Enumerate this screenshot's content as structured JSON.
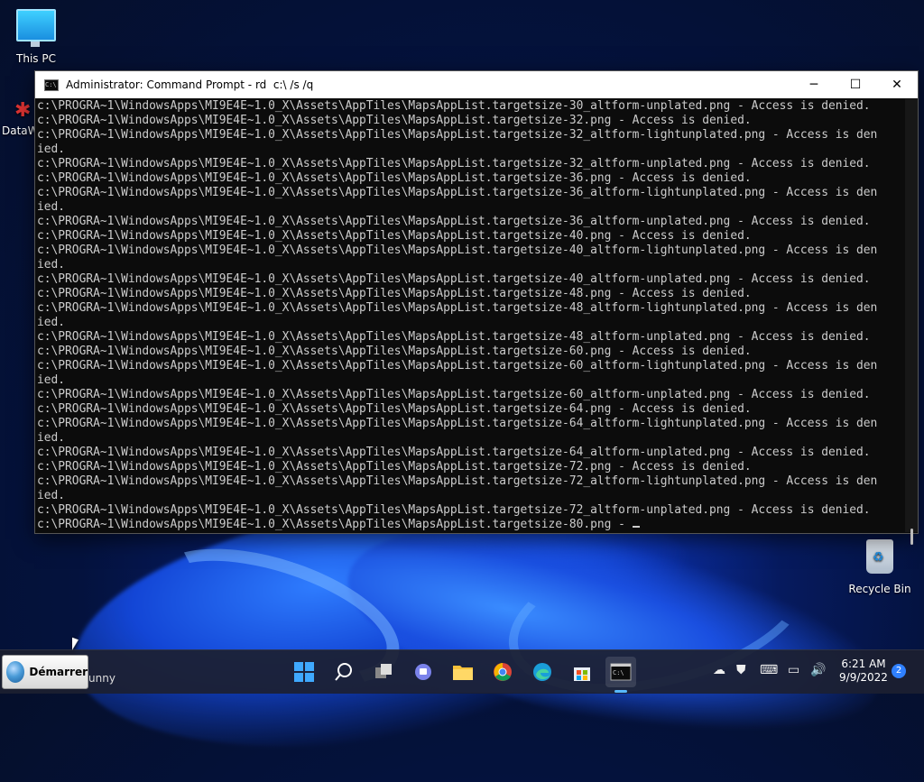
{
  "desktop": {
    "this_pc_label": "This PC",
    "data_label": "DataW",
    "recycle_bin_label": "Recycle Bin"
  },
  "window": {
    "title": "Administrator: Command Prompt - rd  c:\\ /s /q",
    "minimize": "─",
    "maximize": "☐",
    "close": "✕",
    "icon_text": "C:\\",
    "console_lines": [
      "c:\\PROGRA~1\\WindowsApps\\MI9E4E~1.0_X\\Assets\\AppTiles\\MapsAppList.targetsize-30_altform-unplated.png - Access is denied.",
      "c:\\PROGRA~1\\WindowsApps\\MI9E4E~1.0_X\\Assets\\AppTiles\\MapsAppList.targetsize-32.png - Access is denied.",
      "c:\\PROGRA~1\\WindowsApps\\MI9E4E~1.0_X\\Assets\\AppTiles\\MapsAppList.targetsize-32_altform-lightunplated.png - Access is den",
      "ied.",
      "c:\\PROGRA~1\\WindowsApps\\MI9E4E~1.0_X\\Assets\\AppTiles\\MapsAppList.targetsize-32_altform-unplated.png - Access is denied.",
      "c:\\PROGRA~1\\WindowsApps\\MI9E4E~1.0_X\\Assets\\AppTiles\\MapsAppList.targetsize-36.png - Access is denied.",
      "c:\\PROGRA~1\\WindowsApps\\MI9E4E~1.0_X\\Assets\\AppTiles\\MapsAppList.targetsize-36_altform-lightunplated.png - Access is den",
      "ied.",
      "c:\\PROGRA~1\\WindowsApps\\MI9E4E~1.0_X\\Assets\\AppTiles\\MapsAppList.targetsize-36_altform-unplated.png - Access is denied.",
      "c:\\PROGRA~1\\WindowsApps\\MI9E4E~1.0_X\\Assets\\AppTiles\\MapsAppList.targetsize-40.png - Access is denied.",
      "c:\\PROGRA~1\\WindowsApps\\MI9E4E~1.0_X\\Assets\\AppTiles\\MapsAppList.targetsize-40_altform-lightunplated.png - Access is den",
      "ied.",
      "c:\\PROGRA~1\\WindowsApps\\MI9E4E~1.0_X\\Assets\\AppTiles\\MapsAppList.targetsize-40_altform-unplated.png - Access is denied.",
      "c:\\PROGRA~1\\WindowsApps\\MI9E4E~1.0_X\\Assets\\AppTiles\\MapsAppList.targetsize-48.png - Access is denied.",
      "c:\\PROGRA~1\\WindowsApps\\MI9E4E~1.0_X\\Assets\\AppTiles\\MapsAppList.targetsize-48_altform-lightunplated.png - Access is den",
      "ied.",
      "c:\\PROGRA~1\\WindowsApps\\MI9E4E~1.0_X\\Assets\\AppTiles\\MapsAppList.targetsize-48_altform-unplated.png - Access is denied.",
      "c:\\PROGRA~1\\WindowsApps\\MI9E4E~1.0_X\\Assets\\AppTiles\\MapsAppList.targetsize-60.png - Access is denied.",
      "c:\\PROGRA~1\\WindowsApps\\MI9E4E~1.0_X\\Assets\\AppTiles\\MapsAppList.targetsize-60_altform-lightunplated.png - Access is den",
      "ied.",
      "c:\\PROGRA~1\\WindowsApps\\MI9E4E~1.0_X\\Assets\\AppTiles\\MapsAppList.targetsize-60_altform-unplated.png - Access is denied.",
      "c:\\PROGRA~1\\WindowsApps\\MI9E4E~1.0_X\\Assets\\AppTiles\\MapsAppList.targetsize-64.png - Access is denied.",
      "c:\\PROGRA~1\\WindowsApps\\MI9E4E~1.0_X\\Assets\\AppTiles\\MapsAppList.targetsize-64_altform-lightunplated.png - Access is den",
      "ied.",
      "c:\\PROGRA~1\\WindowsApps\\MI9E4E~1.0_X\\Assets\\AppTiles\\MapsAppList.targetsize-64_altform-unplated.png - Access is denied.",
      "c:\\PROGRA~1\\WindowsApps\\MI9E4E~1.0_X\\Assets\\AppTiles\\MapsAppList.targetsize-72.png - Access is denied.",
      "c:\\PROGRA~1\\WindowsApps\\MI9E4E~1.0_X\\Assets\\AppTiles\\MapsAppList.targetsize-72_altform-lightunplated.png - Access is den",
      "ied.",
      "c:\\PROGRA~1\\WindowsApps\\MI9E4E~1.0_X\\Assets\\AppTiles\\MapsAppList.targetsize-72_altform-unplated.png - Access is denied.",
      "c:\\PROGRA~1\\WindowsApps\\MI9E4E~1.0_X\\Assets\\AppTiles\\MapsAppList.targetsize-80.png - "
    ]
  },
  "taskbar": {
    "start_label": "Démarrer",
    "partial_label": "unny",
    "icons": [
      "windows-start-icon",
      "search-icon",
      "task-view-icon",
      "teams-chat-icon",
      "file-explorer-icon",
      "chrome-icon",
      "edge-icon",
      "store-icon",
      "terminal-icon"
    ],
    "clock_time": "6:21 AM",
    "clock_date": "9/9/2022",
    "notification_count": "2"
  },
  "colors": {
    "console_bg": "#0c0c0c",
    "console_fg": "#cccccc",
    "taskbar_bg": "#1c2030",
    "accent": "#58b9ff"
  }
}
